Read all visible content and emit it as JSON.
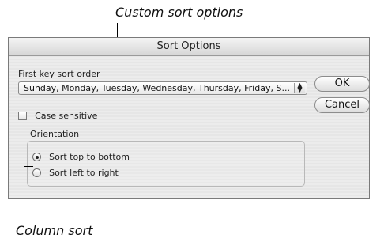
{
  "annotations": {
    "top": "Custom sort options",
    "bottom": "Column sort"
  },
  "dialog": {
    "title": "Sort Options",
    "first_key_label": "First key sort order",
    "first_key_value": "Sunday, Monday, Tuesday, Wednesday, Thursday, Friday, S...",
    "case_sensitive_label": "Case sensitive",
    "case_sensitive_checked": false,
    "orientation_label": "Orientation",
    "orientation_options": [
      {
        "label": "Sort top to bottom",
        "selected": true
      },
      {
        "label": "Sort left to right",
        "selected": false
      }
    ],
    "ok_label": "OK",
    "cancel_label": "Cancel"
  }
}
